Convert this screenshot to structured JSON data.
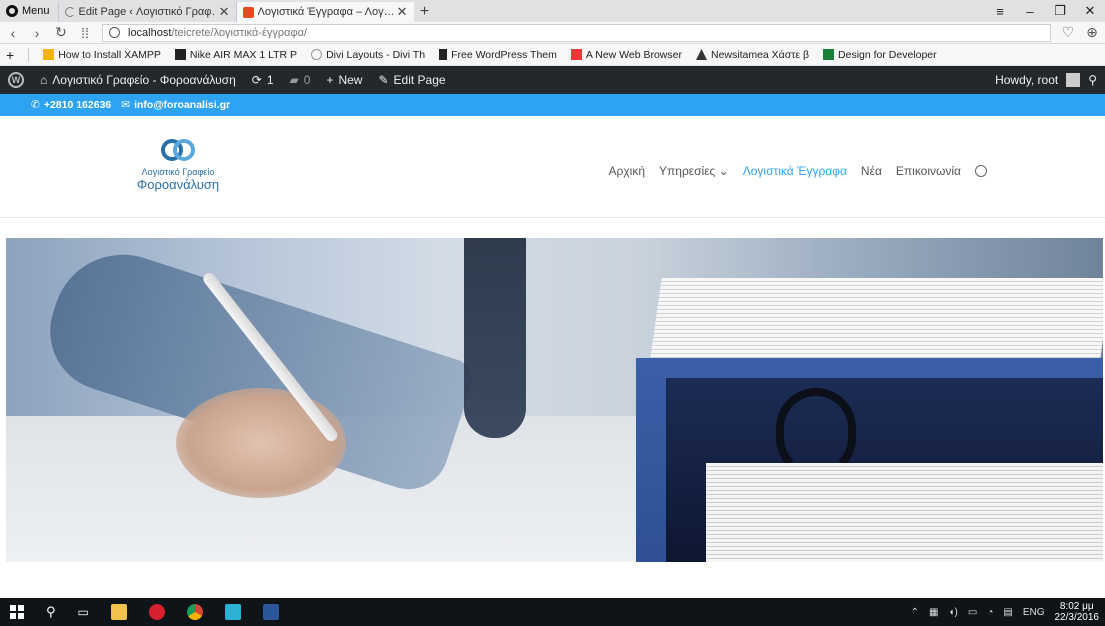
{
  "browser": {
    "menu_label": "Menu",
    "tabs": [
      {
        "title": "Edit Page ‹ Λογιστικό Γραφ…",
        "active": false
      },
      {
        "title": "Λογιστικά Έγγραφα – Λογ…",
        "active": true
      }
    ],
    "url_host": "localhost",
    "url_path": "/teicrete/λογιστικά-έγγραφα/",
    "bookmarks": [
      {
        "label": "How to Install XAMPP",
        "icon": "bookmark-xampp-icon",
        "color": "#f4b400"
      },
      {
        "label": "Nike AIR MAX 1 LTR P",
        "icon": "bookmark-10-icon",
        "color": "#222"
      },
      {
        "label": "Divi Layouts - Divi Th",
        "icon": "bookmark-divi-icon",
        "color": "#999"
      },
      {
        "label": "Free WordPress Them",
        "icon": "bookmark-doc-icon",
        "color": "#222"
      },
      {
        "label": "A New Web Browser",
        "icon": "bookmark-vivaldi-icon",
        "color": "#ef3939"
      },
      {
        "label": "Newsitamea Χάστε β",
        "icon": "bookmark-news-icon",
        "color": "#333"
      },
      {
        "label": "Design for Developer",
        "icon": "bookmark-design-icon",
        "color": "#1a7f37"
      }
    ]
  },
  "wpbar": {
    "site_name": "Λογιστικό Γραφείο - Φοροανάλυση",
    "updates_count": "1",
    "comments_count": "0",
    "new_label": "New",
    "edit_label": "Edit Page",
    "howdy": "Howdy, root"
  },
  "topinfo": {
    "phone": "+2810 162636",
    "email": "info@foroanalisi.gr"
  },
  "site": {
    "logo_line1": "Λογιστικό Γραφείο",
    "logo_line2": "Φοροανάλυση",
    "nav": [
      {
        "label": "Αρχική",
        "active": false
      },
      {
        "label": "Υπηρεσίες ⌄",
        "active": false
      },
      {
        "label": "Λογιστικά Έγγραφα",
        "active": true
      },
      {
        "label": "Νέα",
        "active": false
      },
      {
        "label": "Επικοινωνία",
        "active": false
      }
    ]
  },
  "taskbar": {
    "lang": "ENG",
    "time": "8:02 μμ",
    "date": "22/3/2016"
  },
  "colors": {
    "accent": "#2ea3f2",
    "wp_bar": "#23282d"
  }
}
